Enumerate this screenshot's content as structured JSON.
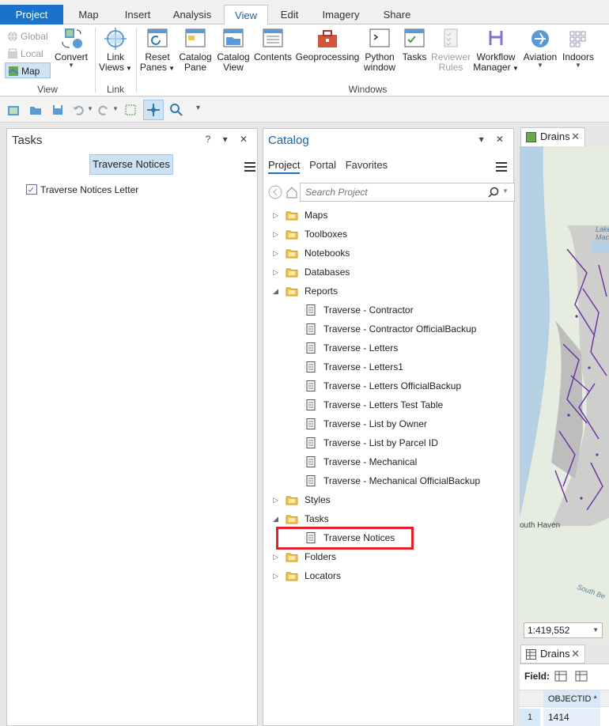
{
  "ribbon_tabs": [
    "Project",
    "Map",
    "Insert",
    "Analysis",
    "View",
    "Edit",
    "Imagery",
    "Share"
  ],
  "ribbon": {
    "view_group": {
      "global": "Global",
      "local": "Local",
      "map": "Map",
      "convert": "Convert",
      "label": "View"
    },
    "link_group": {
      "link_views_1": "Link",
      "link_views_2": "Views",
      "label": "Link"
    },
    "windows_group": {
      "reset_panes_1": "Reset",
      "reset_panes_2": "Panes",
      "catalog_pane_1": "Catalog",
      "catalog_pane_2": "Pane",
      "catalog_view_1": "Catalog",
      "catalog_view_2": "View",
      "contents": "Contents",
      "geoprocessing": "Geoprocessing",
      "python_window_1": "Python",
      "python_window_2": "window",
      "tasks": "Tasks",
      "reviewer_rules_1": "Reviewer",
      "reviewer_rules_2": "Rules",
      "workflow_manager_1": "Workflow",
      "workflow_manager_2": "Manager",
      "aviation": "Aviation",
      "indoors": "Indoors",
      "label": "Windows"
    }
  },
  "tasks_pane": {
    "title": "Tasks",
    "ctrls": "? ▾ ✕",
    "task_button": "Traverse Notices",
    "task_item": "Traverse Notices Letter"
  },
  "catalog_pane": {
    "title": "Catalog",
    "ctrls": "▾ ✕",
    "tabs": [
      "Project",
      "Portal",
      "Favorites"
    ],
    "search_placeholder": "Search Project",
    "tree": [
      {
        "label": "Maps",
        "toggle": "▷",
        "indent": 0
      },
      {
        "label": "Toolboxes",
        "toggle": "▷",
        "indent": 0
      },
      {
        "label": "Notebooks",
        "toggle": "▷",
        "indent": 0
      },
      {
        "label": "Databases",
        "toggle": "▷",
        "indent": 0
      },
      {
        "label": "Reports",
        "toggle": "◢",
        "indent": 0
      },
      {
        "label": "Traverse - Contractor",
        "toggle": "",
        "indent": 1
      },
      {
        "label": "Traverse - Contractor OfficialBackup",
        "toggle": "",
        "indent": 1
      },
      {
        "label": "Traverse - Letters",
        "toggle": "",
        "indent": 1
      },
      {
        "label": "Traverse - Letters1",
        "toggle": "",
        "indent": 1
      },
      {
        "label": "Traverse - Letters OfficialBackup",
        "toggle": "",
        "indent": 1
      },
      {
        "label": "Traverse - Letters Test Table",
        "toggle": "",
        "indent": 1
      },
      {
        "label": "Traverse - List by Owner",
        "toggle": "",
        "indent": 1
      },
      {
        "label": "Traverse - List by Parcel ID",
        "toggle": "",
        "indent": 1
      },
      {
        "label": "Traverse - Mechanical",
        "toggle": "",
        "indent": 1
      },
      {
        "label": "Traverse - Mechanical OfficialBackup",
        "toggle": "",
        "indent": 1
      },
      {
        "label": "Styles",
        "toggle": "▷",
        "indent": 0
      },
      {
        "label": "Tasks",
        "toggle": "◢",
        "indent": 0
      },
      {
        "label": "Traverse Notices",
        "toggle": "",
        "indent": 1
      },
      {
        "label": "Folders",
        "toggle": "▷",
        "indent": 0
      },
      {
        "label": "Locators",
        "toggle": "▷",
        "indent": 0
      }
    ]
  },
  "map_view": {
    "tab": "Drains",
    "labels": [
      "Lake",
      "Macatawa",
      "outh Haven",
      "South Be"
    ],
    "scale": "1:419,552"
  },
  "attribute_table": {
    "tab": "Drains",
    "field_label": "Field:",
    "column": "OBJECTID *",
    "row_num": "1",
    "row_value": "1414"
  }
}
